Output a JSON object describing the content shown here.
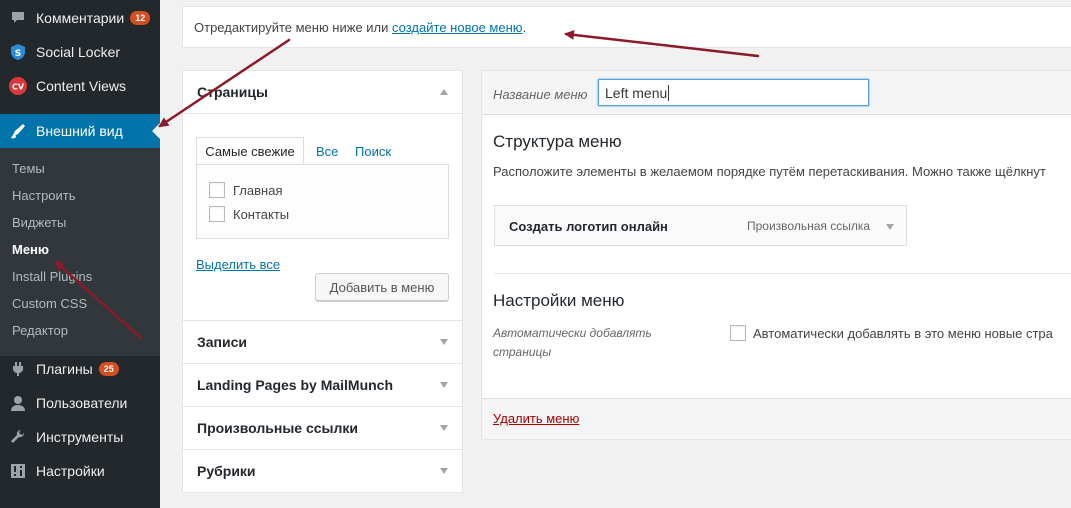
{
  "sidebar": {
    "items": [
      {
        "label": "Комментарии",
        "badge": "12",
        "icon": "comment-icon"
      },
      {
        "label": "Social Locker",
        "icon": "shield-icon"
      },
      {
        "label": "Content Views",
        "icon": "cv-icon",
        "icon_text": "CV"
      },
      {
        "label": "Внешний вид",
        "icon": "paintbrush-icon",
        "active": true
      },
      {
        "label": "Плагины",
        "badge": "25",
        "icon": "plugin-icon"
      },
      {
        "label": "Пользователи",
        "icon": "user-icon"
      },
      {
        "label": "Инструменты",
        "icon": "wrench-icon"
      },
      {
        "label": "Настройки",
        "icon": "settings-icon"
      }
    ],
    "submenu": [
      {
        "label": "Темы"
      },
      {
        "label": "Настроить"
      },
      {
        "label": "Виджеты"
      },
      {
        "label": "Меню",
        "current": true
      },
      {
        "label": "Install Plugins"
      },
      {
        "label": "Custom CSS"
      },
      {
        "label": "Редактор"
      }
    ]
  },
  "notice": {
    "text": "Отредактируйте меню ниже или",
    "link": "создайте новое меню",
    "suffix": "."
  },
  "left_panel": {
    "pages_title": "Страницы",
    "tabs": [
      "Самые свежие",
      "Все",
      "Поиск"
    ],
    "pages": [
      "Главная",
      "Контакты"
    ],
    "select_all": "Выделить все",
    "add_button": "Добавить в меню",
    "sections": [
      "Записи",
      "Landing Pages by MailMunch",
      "Произвольные ссылки",
      "Рубрики"
    ]
  },
  "right_panel": {
    "name_label": "Название меню",
    "name_value": "Left menu",
    "structure_title": "Структура меню",
    "structure_desc": "Расположите элементы в желаемом порядке путём перетаскивания. Можно также щёлкнут",
    "menu_item": {
      "title": "Создать логотип онлайн",
      "type": "Произвольная ссылка"
    },
    "settings_title": "Настройки меню",
    "auto_label": "Автоматически добавлять страницы",
    "auto_text": "Автоматически добавлять в это меню новые стра",
    "delete_link": "Удалить меню"
  },
  "colors": {
    "sidebar_bg": "#23282d",
    "active_bg": "#0073aa",
    "link": "#0073aa",
    "badge": "#d54e21",
    "delete": "#a00000",
    "annotation_arrow": "#8b1a2b"
  }
}
